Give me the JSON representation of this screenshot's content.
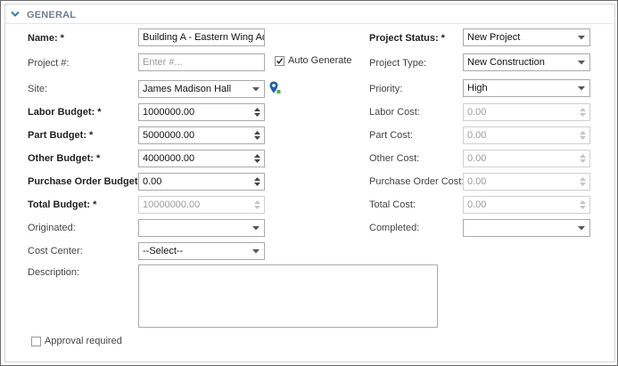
{
  "section": {
    "title": "GENERAL",
    "toggle_icon": "chevron-down-icon"
  },
  "left": {
    "name": {
      "label": "Name: *",
      "value": "Building A - Eastern Wing Addi"
    },
    "project_number": {
      "label": "Project #:",
      "placeholder": "Enter #...",
      "auto_generate_label": "Auto Generate",
      "auto_generate_checked": true
    },
    "site": {
      "label": "Site:",
      "value": "James Madison Hall",
      "icon": "map-pin-icon"
    },
    "labor_budget": {
      "label": "Labor Budget: *",
      "value": "1000000.00"
    },
    "part_budget": {
      "label": "Part Budget: *",
      "value": "5000000.00"
    },
    "other_budget": {
      "label": "Other Budget: *",
      "value": "4000000.00"
    },
    "po_budget": {
      "label": "Purchase Order Budget: *",
      "value": "0.00"
    },
    "total_budget": {
      "label": "Total Budget: *",
      "value": "10000000.00"
    },
    "originated": {
      "label": "Originated:",
      "value": ""
    },
    "cost_center": {
      "label": "Cost Center:",
      "value": "--Select--"
    },
    "description": {
      "label": "Description:",
      "value": ""
    }
  },
  "right": {
    "project_status": {
      "label": "Project Status: *",
      "value": "New Project"
    },
    "project_type": {
      "label": "Project Type:",
      "value": "New Construction"
    },
    "priority": {
      "label": "Priority:",
      "value": "High"
    },
    "labor_cost": {
      "label": "Labor Cost:",
      "value": "0.00"
    },
    "part_cost": {
      "label": "Part Cost:",
      "value": "0.00"
    },
    "other_cost": {
      "label": "Other Cost:",
      "value": "0.00"
    },
    "po_cost": {
      "label": "Purchase Order Cost:",
      "value": "0.00"
    },
    "total_cost": {
      "label": "Total Cost:",
      "value": "0.00"
    },
    "completed": {
      "label": "Completed:",
      "value": ""
    }
  },
  "approval": {
    "label": "Approval required",
    "checked": false
  },
  "colors": {
    "section_title": "#6f7e93",
    "chevron": "#2b7bb9",
    "pin": "#1f5fa8",
    "pin_accent": "#4caf50"
  }
}
